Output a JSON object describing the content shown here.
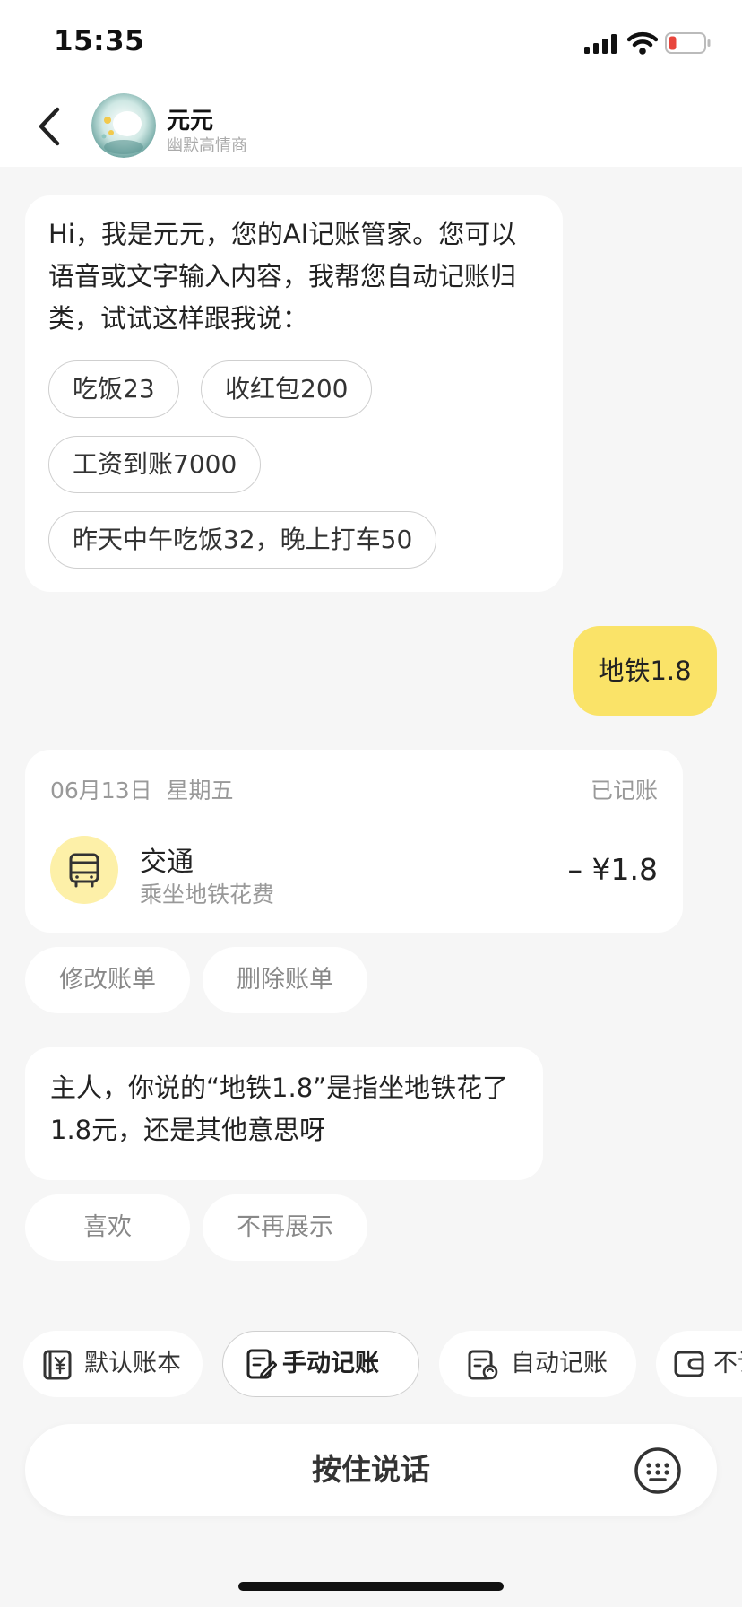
{
  "status_bar": {
    "time": "15:35",
    "icons": [
      "signal-icon",
      "wifi-icon",
      "battery-low-icon"
    ],
    "battery_color": "#e8453c"
  },
  "header": {
    "back_icon": "chevron-left-icon",
    "name": "元元",
    "subtitle": "幽默高情商"
  },
  "intro": {
    "text": "Hi，我是元元，您的AI记账管家。您可以语音或文字输入内容，我帮您自动记账归类，试试这样跟我说：",
    "suggestions": [
      "吃饭23",
      "收红包200",
      "工资到账7000",
      "昨天中午吃饭32，晚上打车50"
    ]
  },
  "user_message": "地铁1.8",
  "record_card": {
    "date": "06月13日",
    "weekday": "星期五",
    "status": "已记账",
    "category": "交通",
    "description": "乘坐地铁花费",
    "amount": "– ¥1.8",
    "icon": "bus-icon",
    "icon_bg": "#fdf0a8"
  },
  "card_actions": {
    "edit": "修改账单",
    "delete": "删除账单"
  },
  "reply": {
    "text": "主人，你说的“地铁1.8”是指坐地铁花了1.8元，还是其他意思呀"
  },
  "feedback": {
    "like": "喜欢",
    "hide": "不再展示"
  },
  "toolbar": {
    "default_book": "默认账本",
    "manual": "手动记账",
    "auto": "自动记账",
    "partial": "不记"
  },
  "voice": {
    "label": "按住说话",
    "keyboard_icon": "keyboard-icon"
  },
  "colors": {
    "accent_yellow": "#fae368",
    "background": "#f6f6f6"
  }
}
